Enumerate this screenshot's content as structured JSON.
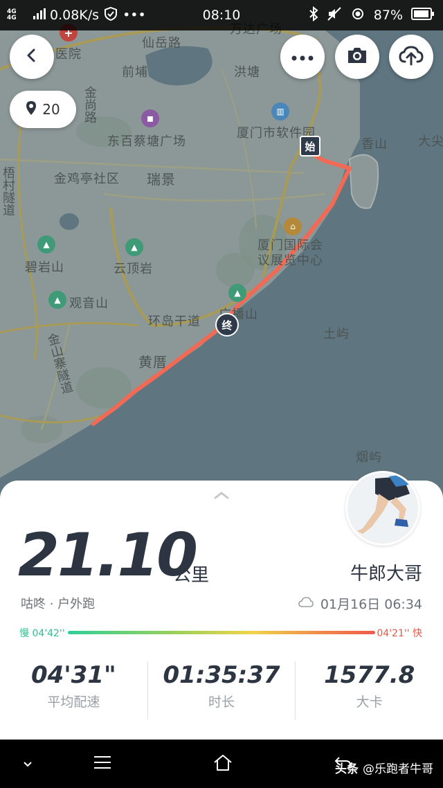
{
  "status_bar": {
    "network": "4G 4G",
    "speed": "0.08K/s",
    "time": "08:10",
    "battery": "87%"
  },
  "map": {
    "waypoint_count": "20",
    "start_marker": "始",
    "end_marker": "终",
    "labels": {
      "xianyue": "仙岳路",
      "wanda": "万达广场",
      "zhongyiyuan": "门中医院",
      "qiankeng": "前埔",
      "hongtang": "洪塘",
      "jinshang": "金尚路",
      "dongbai": "东百蔡塘广场",
      "software_park": "厦门市软件园",
      "xiangshan": "香山",
      "dadan": "大尖",
      "jinji": "金鸡亭社区",
      "ruijing": "瑞景",
      "wucun": "梧村隧道",
      "convention": "厦门国际会议展览中心",
      "biyan": "碧岩山",
      "yunding": "云顶岩",
      "guanyin": "观音山",
      "huandao": "环岛干道",
      "guangbo": "广播山",
      "tuyu": "土屿",
      "huangcuo": "黄厝",
      "jinshanzhai": "金山寨隧道",
      "yanyu": "烟屿"
    }
  },
  "summary": {
    "distance": "21.10",
    "unit": "公里",
    "username": "牛郎大哥",
    "activity": "咕咚 · 户外跑",
    "datetime": "01月16日 06:34",
    "pace_slow_label": "慢 04'42''",
    "pace_fast_label": "04'21'' 快"
  },
  "stats": [
    {
      "value": "04'31\"",
      "label": "平均配速"
    },
    {
      "value": "01:35:37",
      "label": "时长"
    },
    {
      "value": "1577.8",
      "label": "大卡"
    }
  ],
  "watermark": {
    "brand": "头条",
    "account": "@乐跑者牛哥"
  },
  "colors": {
    "route": "#f06a55",
    "text_dark": "#2c3541",
    "pace_slow": "#2ebf8e",
    "pace_fast": "#e3574a"
  }
}
